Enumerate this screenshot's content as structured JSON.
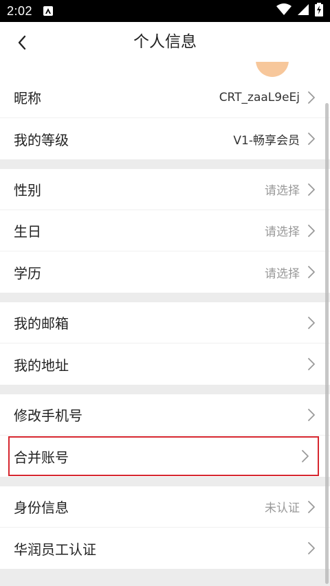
{
  "status_bar": {
    "time": "2:02",
    "app_icon": "A"
  },
  "header": {
    "title": "个人信息"
  },
  "groups": [
    [
      {
        "label": "昵称",
        "value": "CRT_zaaL9eEj",
        "muted": false
      },
      {
        "label": "我的等级",
        "value": "V1-畅享会员",
        "muted": false
      }
    ],
    [
      {
        "label": "性别",
        "value": "请选择",
        "muted": true
      },
      {
        "label": "生日",
        "value": "请选择",
        "muted": true
      },
      {
        "label": "学历",
        "value": "请选择",
        "muted": true
      }
    ],
    [
      {
        "label": "我的邮箱",
        "value": "",
        "muted": false
      },
      {
        "label": "我的地址",
        "value": "",
        "muted": false
      }
    ],
    [
      {
        "label": "修改手机号",
        "value": "",
        "muted": false
      },
      {
        "label": "合并账号",
        "value": "",
        "muted": false
      }
    ],
    [
      {
        "label": "身份信息",
        "value": "未认证",
        "muted": true
      },
      {
        "label": "华润员工认证",
        "value": "",
        "muted": false
      }
    ]
  ],
  "colors": {
    "highlight": "#d6262e",
    "avatar": "#f7c79b"
  }
}
